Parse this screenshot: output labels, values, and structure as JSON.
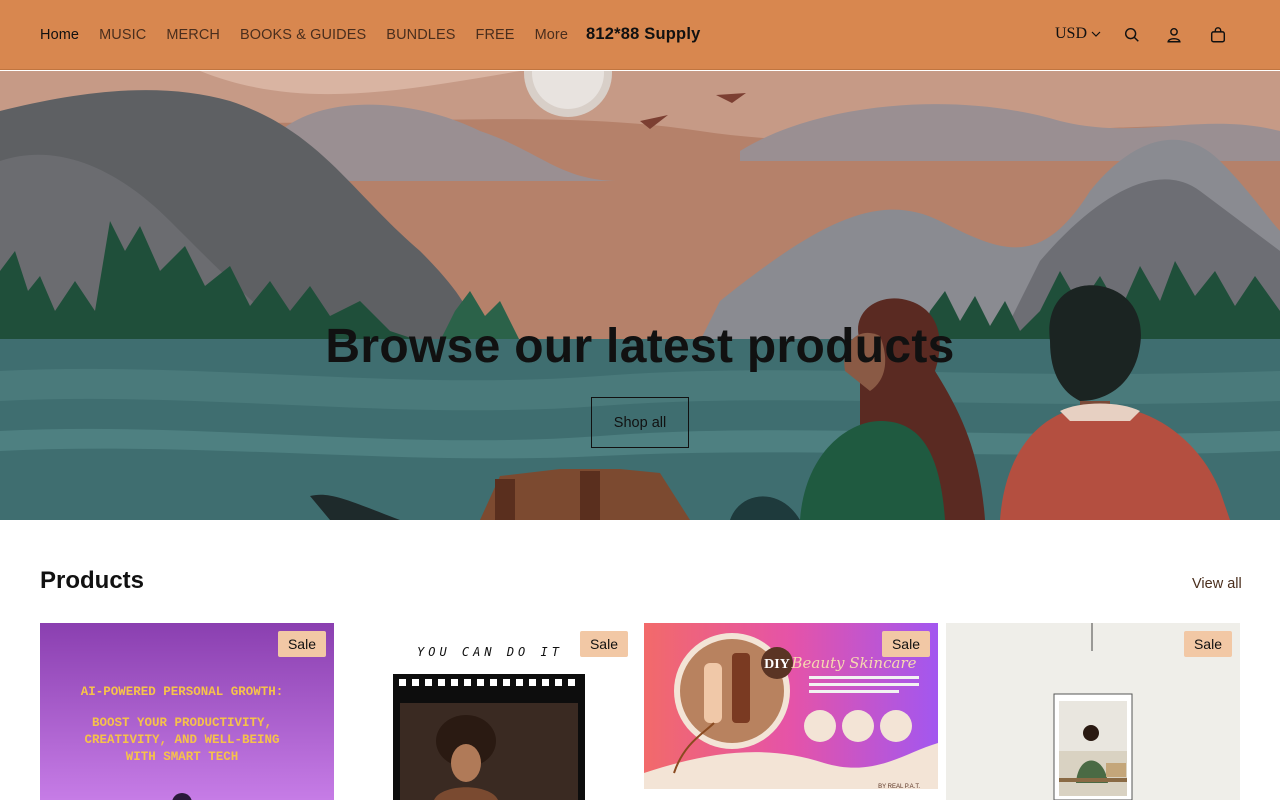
{
  "nav": {
    "items": [
      {
        "label": "Home",
        "active": true
      },
      {
        "label": "MUSIC"
      },
      {
        "label": "MERCH"
      },
      {
        "label": "BOOKS & GUIDES"
      },
      {
        "label": "BUNDLES"
      },
      {
        "label": "FREE"
      },
      {
        "label": "More"
      }
    ]
  },
  "brand": "812*88 Supply",
  "header": {
    "currency": "USD",
    "icons": [
      "search-icon",
      "account-icon",
      "cart-icon"
    ],
    "color": "#d8874f"
  },
  "hero": {
    "title": "Browse our latest products",
    "button_label": "Shop all"
  },
  "products": {
    "title": "Products",
    "view_all": "View all",
    "cards": [
      {
        "badge": "Sale",
        "image_lines": [
          "AI-POWERED PERSONAL GROWTH:",
          "BOOST YOUR PRODUCTIVITY,",
          "CREATIVITY, AND WELL-BEING",
          "WITH SMART TECH"
        ]
      },
      {
        "badge": "Sale",
        "image_lines": [
          "YOU CAN DO IT"
        ]
      },
      {
        "badge": "Sale",
        "image_lines": [
          "DIY",
          "Beauty Skincare",
          "BY REAL P.A.T."
        ]
      },
      {
        "badge": "Sale",
        "image_lines": []
      }
    ]
  }
}
